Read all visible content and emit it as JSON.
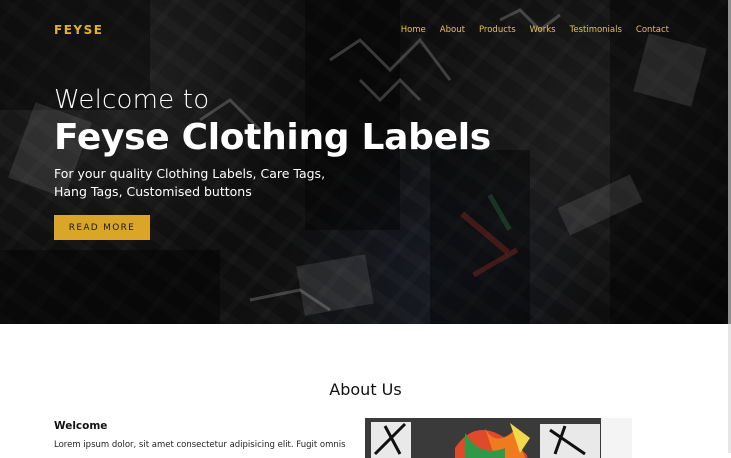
{
  "nav": {
    "logo": "FEYSE",
    "links": [
      "Home",
      "About",
      "Products",
      "Works",
      "Testimonials",
      "Contact"
    ]
  },
  "hero": {
    "welcome": "Welcome to",
    "headline": "Feyse Clothing Labels",
    "subline1": "For your quality Clothing Labels, Care Tags,",
    "subline2": "Hang Tags, Customised buttons",
    "cta_label": "READ MORE"
  },
  "about": {
    "title": "About Us",
    "heading": "Welcome",
    "paragraph": "Lorem ipsum dolor, sit amet consectetur adipisicing elit. Fugit omnis"
  },
  "colors": {
    "accent": "#dba628",
    "nav_text": "#e7c04a",
    "hero_bg": "#141414"
  }
}
